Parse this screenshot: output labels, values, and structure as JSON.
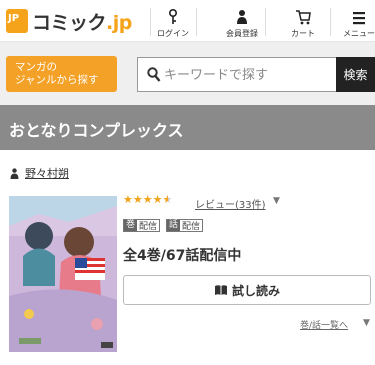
{
  "header": {
    "logo_text": "コミック",
    "logo_suffix": ".jp",
    "nav": [
      {
        "label": "ログイン",
        "icon": "key-icon"
      },
      {
        "label": "会員登録",
        "icon": "user-icon"
      },
      {
        "label": "カート",
        "icon": "cart-icon"
      },
      {
        "label": "メニュー",
        "icon": "menu-icon"
      }
    ]
  },
  "search": {
    "genre_button": [
      "マンガの",
      "ジャンルから探す"
    ],
    "placeholder": "キーワードで探す",
    "button_label": "検索"
  },
  "title": "おとなりコンプレックス",
  "author": "野々村朔",
  "rating": {
    "stars": 4.5,
    "review_label": "レビュー(33件)"
  },
  "badges": [
    {
      "key": "巻",
      "value": "配信"
    },
    {
      "key": "話",
      "value": "配信"
    }
  ],
  "volumes_text": "全4巻/67話配信中",
  "trial_button": "試し読み",
  "volume_list_link": "巻/話一覧へ",
  "colors": {
    "accent": "#f4a127",
    "title_band": "#8a8a8a",
    "star": "#f2a31a"
  }
}
